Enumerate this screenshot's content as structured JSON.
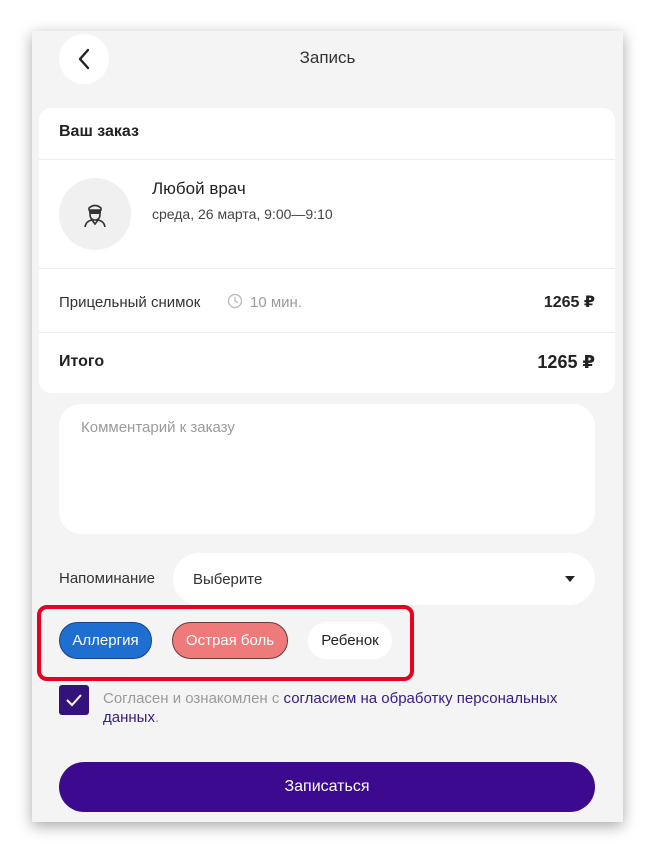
{
  "header": {
    "title": "Запись",
    "back_icon": "chevron-left-icon"
  },
  "order": {
    "heading": "Ваш заказ",
    "doctor": {
      "name": "Любой врач",
      "datetime": "среда, 26 марта, 9:00—9:10",
      "avatar_icon": "doctor-icon"
    },
    "service": {
      "name": "Прицельный снимок",
      "duration_icon": "clock-icon",
      "duration": "10 мин.",
      "price": "1265 ₽"
    },
    "total": {
      "label": "Итого",
      "price": "1265 ₽"
    }
  },
  "comment": {
    "placeholder": "Комментарий к заказу",
    "value": ""
  },
  "reminder": {
    "label": "Напоминание",
    "selected": "Выберите"
  },
  "tags": [
    {
      "label": "Аллергия",
      "selected": true,
      "color": "#1f6fd1"
    },
    {
      "label": "Острая боль",
      "selected": true,
      "color": "#ee7a7a"
    },
    {
      "label": "Ребенок",
      "selected": false,
      "color": "#ffffff"
    }
  ],
  "consent": {
    "checked": true,
    "text": "Согласен и ознакомлен с ",
    "link_text": "согласием на обработку персональных данных",
    "suffix": "."
  },
  "submit": {
    "label": "Записаться"
  },
  "colors": {
    "primary": "#3c0a8f",
    "checkbox": "#33137a",
    "highlight": "#e8001c",
    "background": "#f4f4f4"
  }
}
